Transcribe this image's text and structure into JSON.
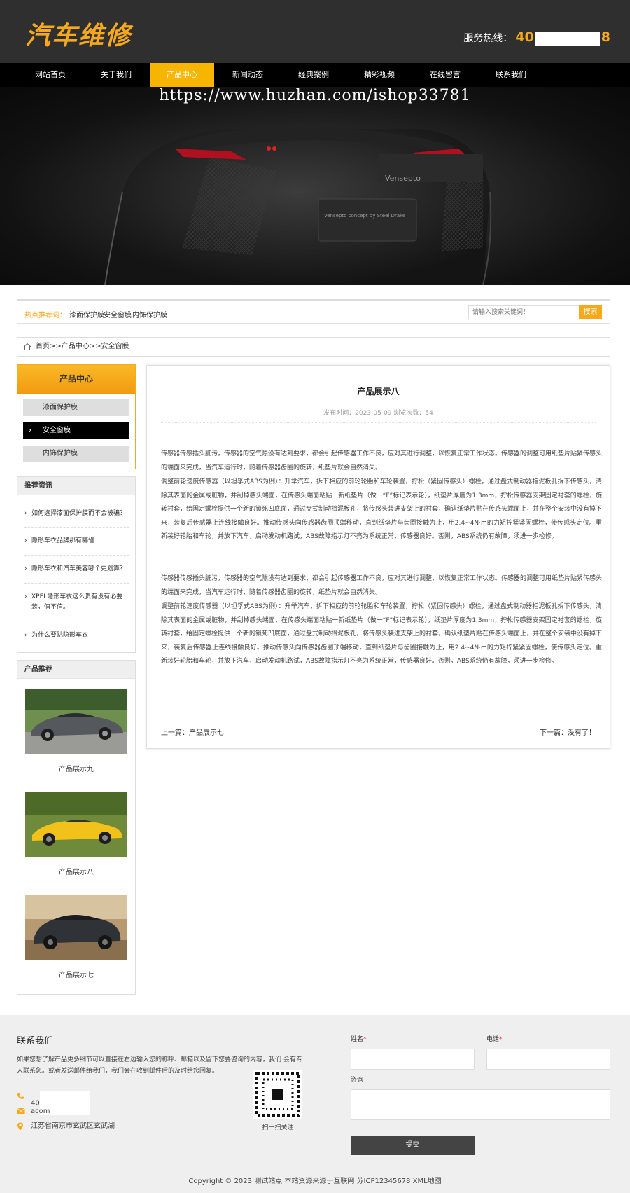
{
  "header": {
    "logo": "汽车维修",
    "hotline_label": "服务热线：",
    "hotline_prefix": "40",
    "hotline_suffix": "8"
  },
  "nav": [
    {
      "label": "网站首页"
    },
    {
      "label": "关于我们"
    },
    {
      "label": "产品中心"
    },
    {
      "label": "新闻动态"
    },
    {
      "label": "经典案例"
    },
    {
      "label": "精彩视频"
    },
    {
      "label": "在线留言"
    },
    {
      "label": "联系我们"
    }
  ],
  "banner": {
    "watermark": "https://www.huzhan.com/ishop33781",
    "car_brand": "Vensepto",
    "plate_line1": "Vensepto concept by Steel Drake"
  },
  "hot": {
    "label": "热点推荐词：",
    "links": [
      "漆面保护膜",
      "安全窗膜",
      "内饰保护膜"
    ],
    "search_placeholder": "请输入搜索关键词！",
    "search_button": "搜索"
  },
  "breadcrumb": "首页>>产品中心>>安全窗膜",
  "sidebar": {
    "category_title": "产品中心",
    "categories": [
      {
        "label": "漆面保护膜"
      },
      {
        "label": "安全窗膜"
      },
      {
        "label": "内饰保护膜"
      }
    ],
    "news_title": "推荐资讯",
    "news": [
      "如何选择漆面保护膜而不会被骗？",
      "隐形车衣品牌那有哪省",
      "隐形车衣和汽车美容哪个更划算？",
      "XPEL隐形车衣这么贵有没有必要装，值不值。",
      "为什么要贴隐形车衣"
    ],
    "products_title": "产品推荐",
    "products": [
      "产品展示九",
      "产品展示八",
      "产品展示七"
    ]
  },
  "article": {
    "title": "产品展示八",
    "meta": "发布时间：2023-05-09 浏览次数：54",
    "paragraphs": [
      "传感器传感插头脏污，传感器的空气隙没有达到要求，都会引起传感器工作不良，应对其进行调整，以恢复正常工作状态。传感器的调整可用纸垫片贴紧传感头的端面来完成，当汽车运行时，随着传感器齿圈的旋转，纸垫片就会自然消失。",
      "调整前轮速度传感器（以坦孚式ABS为例）：升举汽车，拆下相应的前轮轮胎和车轮装置，拧松（紧固传感头）螺栓，通过盘式制动器指泥板孔拆下传感头，清除其表面的金属或脏物，并刮掉感头端面，在传感头端面粘贴一新纸垫片（做一“F”标记表示轮），纸垫片厚度为1.3mm，拧松传感器支架固定衬套的螺栓，旋转衬套，给固定螺栓提供一个新的锁死凹底面，通过盘式制动挡泥板孔，将传感头装进支架上的衬套，确认纸垫片贴在传感头端面上，并在整个安装中没有掉下来，装复后传感器上连线接触良好。推动传感头向传感器齿圈顶端移动，直到纸垫片与齿圈接触为止，用2.4~4N·m的力矩拧紧紧固螺栓，使传感头定位。重新装好轮胎和车轮，并放下汽车，启动发动机路试，ABS故障指示灯不亮为系统正常，传感器良好。否则，ABS系统仍有故障，须进一步检修。",
      "传感器传感插头脏污，传感器的空气隙没有达到要求，都会引起传感器工作不良，应对其进行调整，以恢复正常工作状态。传感器的调整可用纸垫片贴紧传感头的端面来完成，当汽车运行时，随着传感器齿圈的旋转，纸垫片就会自然消失。",
      "调整前轮速度传感器（以坦孚式ABS为例）：升举汽车，拆下相应的前轮轮胎和车轮装置，拧松（紧固传感头）螺栓，通过盘式制动器指泥板孔拆下传感头，清除其表面的金属或脏物，并刮掉感头端面，在传感头端面粘贴一新纸垫片（做一“F”标记表示轮），纸垫片厚度为1.3mm，拧松传感器支架固定衬套的螺栓，旋转衬套，给固定螺栓提供一个新的锁死凹底面，通过盘式制动挡泥板孔，将传感头装进支架上的衬套，确认纸垫片贴在传感头端面上，并在整个安装中没有掉下来，装复后传感器上连线接触良好。推动传感头向传感器齿圈顶端移动，直到纸垫片与齿圈接触为止，用2.4~4N·m的力矩拧紧紧固螺栓，使传感头定位。重新装好轮胎和车轮，并放下汽车，启动发动机路试，ABS故障指示灯不亮为系统正常，传感器良好。否则，ABS系统仍有故障，须进一步检修。"
    ],
    "prev": "上一篇：产品展示七",
    "next": "下一篇：没有了！"
  },
  "footer": {
    "title": "联系我们",
    "desc": "如果您想了解产品更多细节可以直接在右边输入您的称呼、邮箱以及留下您要咨询的内容，我们 会有专人联系您。或者发送邮件给我们，我们会在收到邮件后的及时给您回复。",
    "phone_prefix": "40",
    "email_prefix": "ac",
    "email_suffix": "om",
    "address": "江苏省南京市玄武区玄武湖",
    "qr_label": "扫一扫关注",
    "name_label": "姓名",
    "phone_label": "电话",
    "consult_label": "咨询",
    "submit": "提交",
    "copyright": "Copyright © 2023 测试站点 本站资源来源于互联网 苏ICP12345678 XML地图"
  },
  "colors": {
    "accent": "#f7a91b",
    "header_bg": "#2f2f2f",
    "nav_bg": "#000000",
    "footer_bg": "#efefef"
  }
}
